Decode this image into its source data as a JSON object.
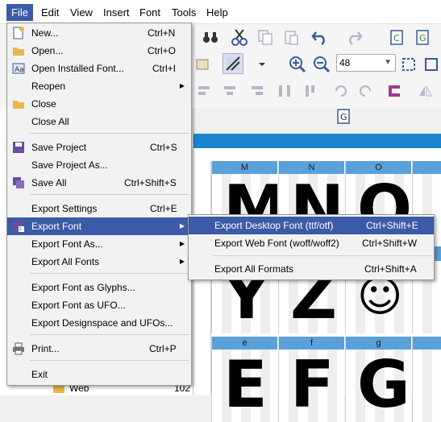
{
  "menubar": {
    "items": [
      "File",
      "Edit",
      "View",
      "Insert",
      "Font",
      "Tools",
      "Help"
    ]
  },
  "toolbar": {
    "zoom_value": "48"
  },
  "file_menu": {
    "items": [
      {
        "label": "New...",
        "shortcut": "Ctrl+N"
      },
      {
        "label": "Open...",
        "shortcut": "Ctrl+O"
      },
      {
        "label": "Open Installed Font...",
        "shortcut": "Ctrl+I"
      },
      {
        "label": "Reopen",
        "shortcut": ""
      },
      {
        "label": "Close",
        "shortcut": ""
      },
      {
        "label": "Close All",
        "shortcut": ""
      },
      {
        "label": "Save Project",
        "shortcut": "Ctrl+S"
      },
      {
        "label": "Save Project As...",
        "shortcut": ""
      },
      {
        "label": "Save All",
        "shortcut": "Ctrl+Shift+S"
      },
      {
        "label": "Export Settings",
        "shortcut": "Ctrl+E"
      },
      {
        "label": "Export Font",
        "shortcut": ""
      },
      {
        "label": "Export Font As...",
        "shortcut": ""
      },
      {
        "label": "Export All Fonts",
        "shortcut": ""
      },
      {
        "label": "Export Font as Glyphs...",
        "shortcut": ""
      },
      {
        "label": "Export Font as UFO...",
        "shortcut": ""
      },
      {
        "label": "Export Designspace and UFOs...",
        "shortcut": ""
      },
      {
        "label": "Print...",
        "shortcut": "Ctrl+P"
      },
      {
        "label": "Exit",
        "shortcut": ""
      }
    ]
  },
  "export_submenu": {
    "items": [
      {
        "label": "Export Desktop Font (ttf/otf)",
        "shortcut": "Ctrl+Shift+E"
      },
      {
        "label": "Export Web Font (woff/woff2)",
        "shortcut": "Ctrl+Shift+W"
      },
      {
        "label": "Export All Formats",
        "shortcut": "Ctrl+Shift+A"
      }
    ]
  },
  "glyph_grid": {
    "row1": [
      {
        "label": "M",
        "glyph": "M"
      },
      {
        "label": "N",
        "glyph": "N"
      },
      {
        "label": "O",
        "glyph": "O"
      }
    ],
    "row2": [
      {
        "glyph": "Y"
      },
      {
        "glyph": "Z"
      },
      {
        "glyph": "☺"
      }
    ],
    "row3": [
      {
        "label": "e",
        "glyph": "E"
      },
      {
        "label": "f",
        "glyph": "F"
      },
      {
        "label": "g",
        "glyph": "G"
      }
    ]
  },
  "left_panel": {
    "folder_label": "Web",
    "folder_count": "102"
  }
}
